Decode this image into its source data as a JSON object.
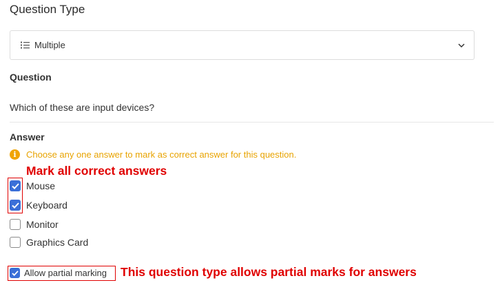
{
  "question_type": {
    "title": "Question Type",
    "selected": "Multiple",
    "icon": "list-icon"
  },
  "question": {
    "label": "Question",
    "text": "Which of these are input devices?"
  },
  "answer": {
    "label": "Answer",
    "hint": "Choose any one answer to mark as correct answer for this question.",
    "options": [
      {
        "label": "Mouse",
        "checked": true
      },
      {
        "label": "Keyboard",
        "checked": true
      },
      {
        "label": "Monitor",
        "checked": false
      },
      {
        "label": "Graphics Card",
        "checked": false
      }
    ]
  },
  "partial_marking": {
    "label": "Allow partial marking",
    "checked": true
  },
  "annotations": {
    "correct": "Mark all correct answers",
    "partial": "This question type allows partial marks for answers"
  },
  "colors": {
    "accent": "#3a6fd8",
    "hint": "#e8a300",
    "annotation": "#e00000"
  }
}
